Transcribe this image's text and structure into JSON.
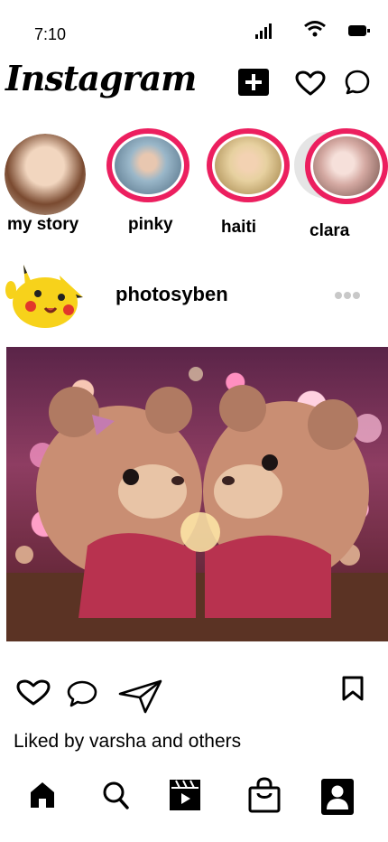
{
  "status_bar": {
    "time": "7:10",
    "icons": [
      "signal-icon",
      "wifi-icon",
      "battery-icon"
    ]
  },
  "header": {
    "logo_text": "Instagram",
    "icons": [
      "new-post-icon",
      "heart-icon",
      "messenger-icon"
    ]
  },
  "stories": [
    {
      "label": "my story",
      "colors": [
        "#d8b79c",
        "#8a5a3c"
      ],
      "ring": false
    },
    {
      "label": "pinky",
      "colors": [
        "#9ab7c9",
        "#4d6a80"
      ],
      "ring": true
    },
    {
      "label": "haiti",
      "colors": [
        "#e7d1a0",
        "#9b7b3f"
      ],
      "ring": true
    },
    {
      "label": "clara",
      "colors": [
        "#f0d6d0",
        "#b78d86"
      ],
      "ring": true
    }
  ],
  "post": {
    "username": "photosyben",
    "liked_text": "Liked by varsha and others"
  },
  "colors": {
    "story_ring": "#ec1f5f",
    "more_dots": "#c8c8c8"
  },
  "bottom_nav": [
    "home-icon",
    "search-icon",
    "reels-icon",
    "shop-icon",
    "profile-icon"
  ]
}
